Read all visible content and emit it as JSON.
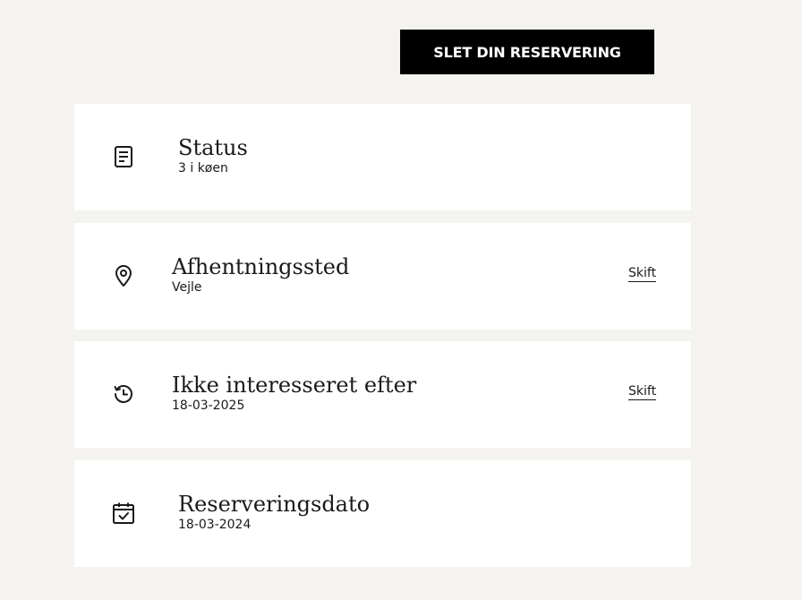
{
  "delete_button": {
    "label": "SLET DIN RESERVERING"
  },
  "details": [
    {
      "icon": "document-icon",
      "title": "Status",
      "value": "3 i køen"
    },
    {
      "icon": "location-pin-icon",
      "title": "Afhentningssted",
      "value": "Vejle",
      "action_label": "Skift"
    },
    {
      "icon": "history-clock-icon",
      "title": "Ikke interesseret efter",
      "value": "18-03-2025",
      "action_label": "Skift"
    },
    {
      "icon": "calendar-check-icon",
      "title": "Reserveringsdato",
      "value": "18-03-2024"
    }
  ]
}
